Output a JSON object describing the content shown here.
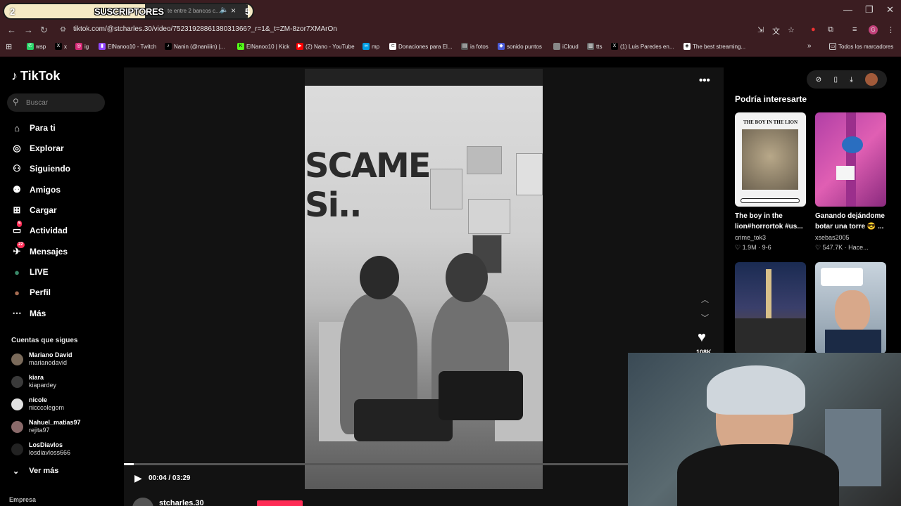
{
  "overlay": {
    "left_count": "2",
    "title": "SUSCRIPTORES",
    "tab_text": "te entre 2 bancos c...",
    "right_count": "5"
  },
  "browser": {
    "url": "tiktok.com/@stcharles.30/video/7523192886138031366?_r=1&_t=ZM-8zor7XMArOn",
    "bookmarks": [
      "wsp",
      "x",
      "ig",
      "ElNanoo10 - Twitch",
      "Nanin (@naniiiin) |...",
      "ElNanoo10 | Kick",
      "(2) Nano - YouTube",
      "mp",
      "Donaciones para El...",
      "ia fotos",
      "sonido puntos",
      "iCloud",
      "tts",
      "(1) Luis Paredes en...",
      "The best streaming..."
    ],
    "all_bookmarks": "Todos los marcadores"
  },
  "sidebar": {
    "logo": "TikTok",
    "search_placeholder": "Buscar",
    "nav": [
      {
        "label": "Para ti",
        "icon": "home-icon"
      },
      {
        "label": "Explorar",
        "icon": "compass-icon"
      },
      {
        "label": "Siguiendo",
        "icon": "user-follow-icon"
      },
      {
        "label": "Amigos",
        "icon": "friends-icon"
      },
      {
        "label": "Cargar",
        "icon": "upload-icon"
      },
      {
        "label": "Actividad",
        "icon": "activity-icon",
        "badge": "5"
      },
      {
        "label": "Mensajes",
        "icon": "messages-icon",
        "badge": "22"
      },
      {
        "label": "LIVE",
        "icon": "live-icon"
      },
      {
        "label": "Perfil",
        "icon": "profile-icon"
      },
      {
        "label": "Más",
        "icon": "more-icon"
      }
    ],
    "following_title": "Cuentas que sigues",
    "accounts": [
      {
        "name": "Mariano David",
        "handle": "marianodavid"
      },
      {
        "name": "kiara",
        "handle": "kiapardey"
      },
      {
        "name": "nicole",
        "handle": "nicccolegom"
      },
      {
        "name": "Nahuel_matias97",
        "handle": "rejita97"
      },
      {
        "name": "LosDiavlos",
        "handle": "losdiavloss666"
      }
    ],
    "see_more": "Ver más",
    "footer": "Empresa"
  },
  "video": {
    "wall_text": "SCAME\nSi..",
    "time": "00:04 / 03:29",
    "progress": 0.02,
    "likes": "108K",
    "author": "stcharles.30"
  },
  "recommendations": {
    "title": "Podría interesarte",
    "cards": [
      {
        "title": "The boy in the lion#horrortok #us...",
        "author": "crime_tok3",
        "stats": "♡ 1.9M · 9-6",
        "thumb_text": "THE BOY IN THE LION"
      },
      {
        "title": "Ganando dejándome botar una torre 😎 ...",
        "author": "xsebas2005",
        "stats": "♡ 547.7K · Hace..."
      },
      {
        "title": "",
        "author": "",
        "stats": ""
      },
      {
        "title": "",
        "author": "",
        "stats": ""
      }
    ]
  }
}
